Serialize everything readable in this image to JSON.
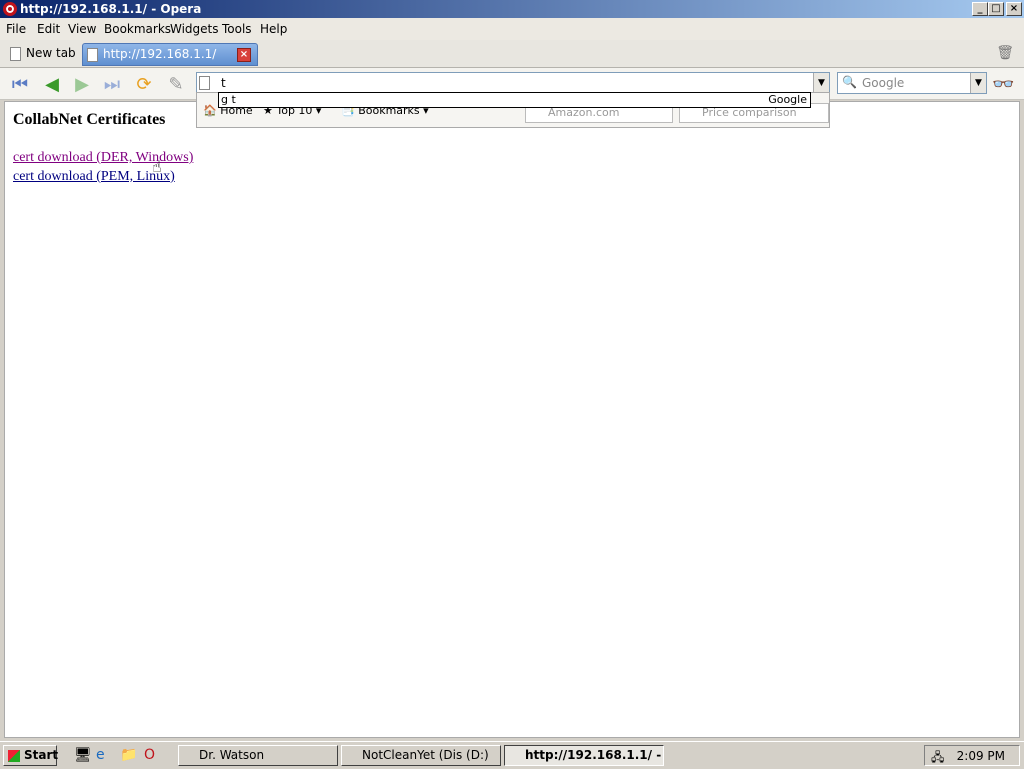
{
  "window": {
    "title": "http://192.168.1.1/ - Opera"
  },
  "menu": [
    "File",
    "Edit",
    "View",
    "Bookmarks",
    "Widgets",
    "Tools",
    "Help"
  ],
  "tabs": {
    "new_tab": "New tab",
    "active_tab": "http://192.168.1.1/"
  },
  "address": {
    "value": "t"
  },
  "search": {
    "placeholder": "Google"
  },
  "suggestion": {
    "query": "g t",
    "engine": "Google"
  },
  "speedbar": {
    "home": "Home",
    "top10": "Top 10",
    "bookmarks": "Bookmarks",
    "amazon": "Amazon.com",
    "price": "Price comparison"
  },
  "page": {
    "heading": "CollabNet Certificates",
    "links": [
      "cert download (DER, Windows)",
      "cert download (PEM, Linux)"
    ]
  },
  "taskbar": {
    "start": "Start",
    "tasks": [
      "Dr. Watson",
      "NotCleanYet (Dis (D:)",
      "http://192.168.1.1/ - ..."
    ],
    "clock": "2:09 PM"
  }
}
